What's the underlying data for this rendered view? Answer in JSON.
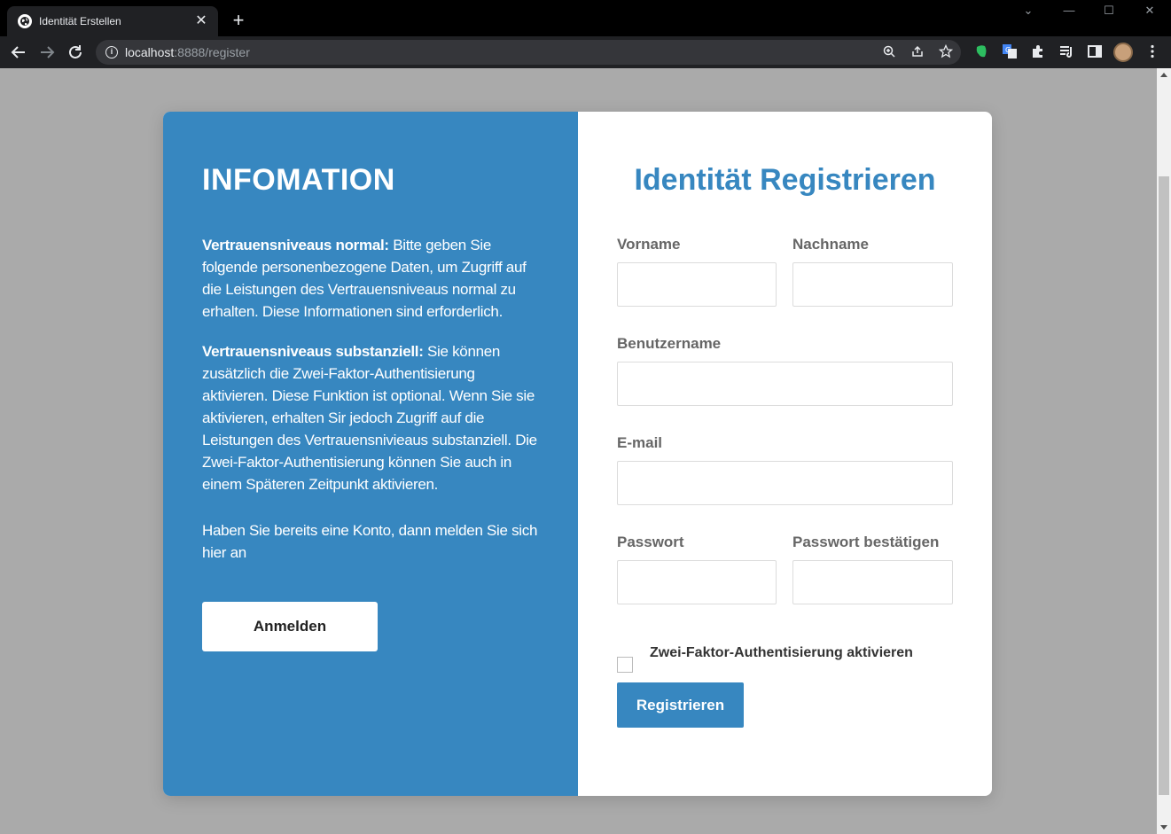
{
  "browser": {
    "tab_title": "Identität Erstellen",
    "tab_close": "✕",
    "new_tab": "+",
    "url_host": "localhost",
    "url_rest": ":8888/register",
    "window_controls": [
      "⌄",
      "—",
      "☐",
      "✕"
    ]
  },
  "info": {
    "heading": "INFOMATION",
    "p1_bold": "Vertrauensniveaus normal:",
    "p1_text": " Bitte geben Sie folgende personenbezogene Daten, um Zugriff auf die Leistungen des Vertrauensniveaus normal zu erhalten. Diese Informationen sind erforderlich.",
    "p2_bold": "Vertrauensniveaus substanziell:",
    "p2_text": " Sie können zusätzlich die Zwei-Faktor-Authentisierung aktivieren. Diese Funktion ist optional. Wenn Sie sie aktivieren, erhalten Sir jedoch Zugriff auf die Leistungen des Vertrauensnivieaus substanziell. Die Zwei-Faktor-Authentisierung können Sie auch in einem Späteren Zeitpunkt aktivieren.",
    "p3_text": "Haben Sie bereits eine Konto, dann melden Sie sich hier an",
    "login_button": "Anmelden"
  },
  "form": {
    "title": "Identität Registrieren",
    "firstname_label": "Vorname",
    "firstname_value": "",
    "lastname_label": "Nachname",
    "lastname_value": "",
    "username_label": "Benutzername",
    "username_value": "",
    "email_label": "E-mail",
    "email_value": "",
    "password_label": "Passwort",
    "password_value": "",
    "password_confirm_label": "Passwort bestätigen",
    "password_confirm_value": "",
    "twofactor_label": "Zwei-Faktor-Authentisierung aktivieren",
    "twofactor_checked": false,
    "register_button": "Registrieren"
  },
  "colors": {
    "accent": "#3787c0",
    "page_background": "#aaaaaa"
  }
}
